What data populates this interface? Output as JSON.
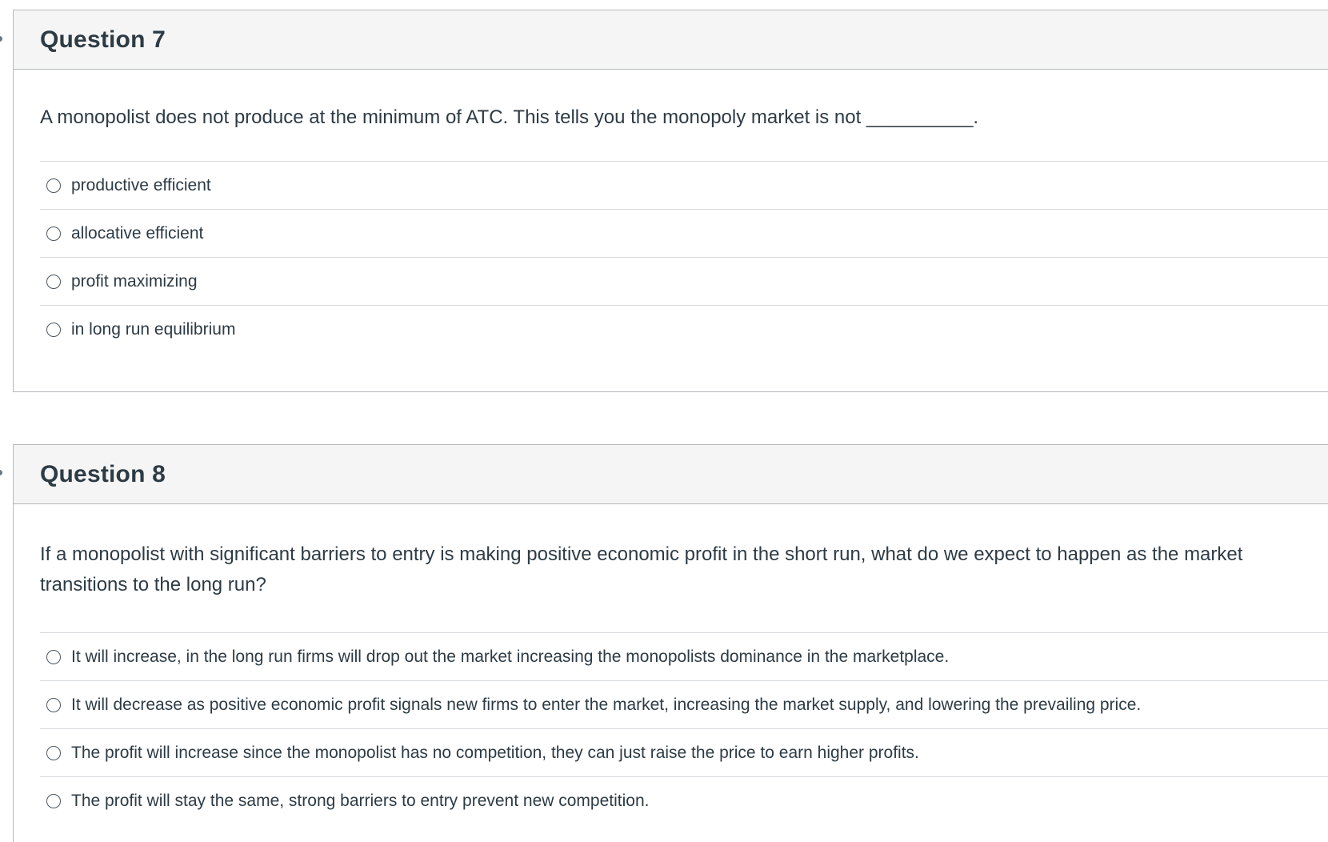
{
  "questions": [
    {
      "title": "Question 7",
      "text": "A monopolist does not produce at the minimum of ATC.  This tells you the monopoly market is not __________.",
      "answers": [
        "productive efficient",
        "allocative efficient",
        "profit maximizing",
        "in long run equilibrium"
      ]
    },
    {
      "title": "Question 8",
      "text": "If a monopolist with significant barriers to entry is making positive economic profit in the short run, what do we expect to happen as the market transitions to the long run?",
      "answers": [
        "It will increase, in the long run firms will drop out the market increasing the monopolists dominance in the marketplace.",
        "It will decrease as positive economic profit signals new firms to enter the market, increasing the market supply, and lowering the prevailing price.",
        "The profit will increase since the monopolist has no competition, they can just raise the price to earn higher profits.",
        "The profit will stay the same, strong barriers to entry prevent new competition."
      ]
    }
  ]
}
